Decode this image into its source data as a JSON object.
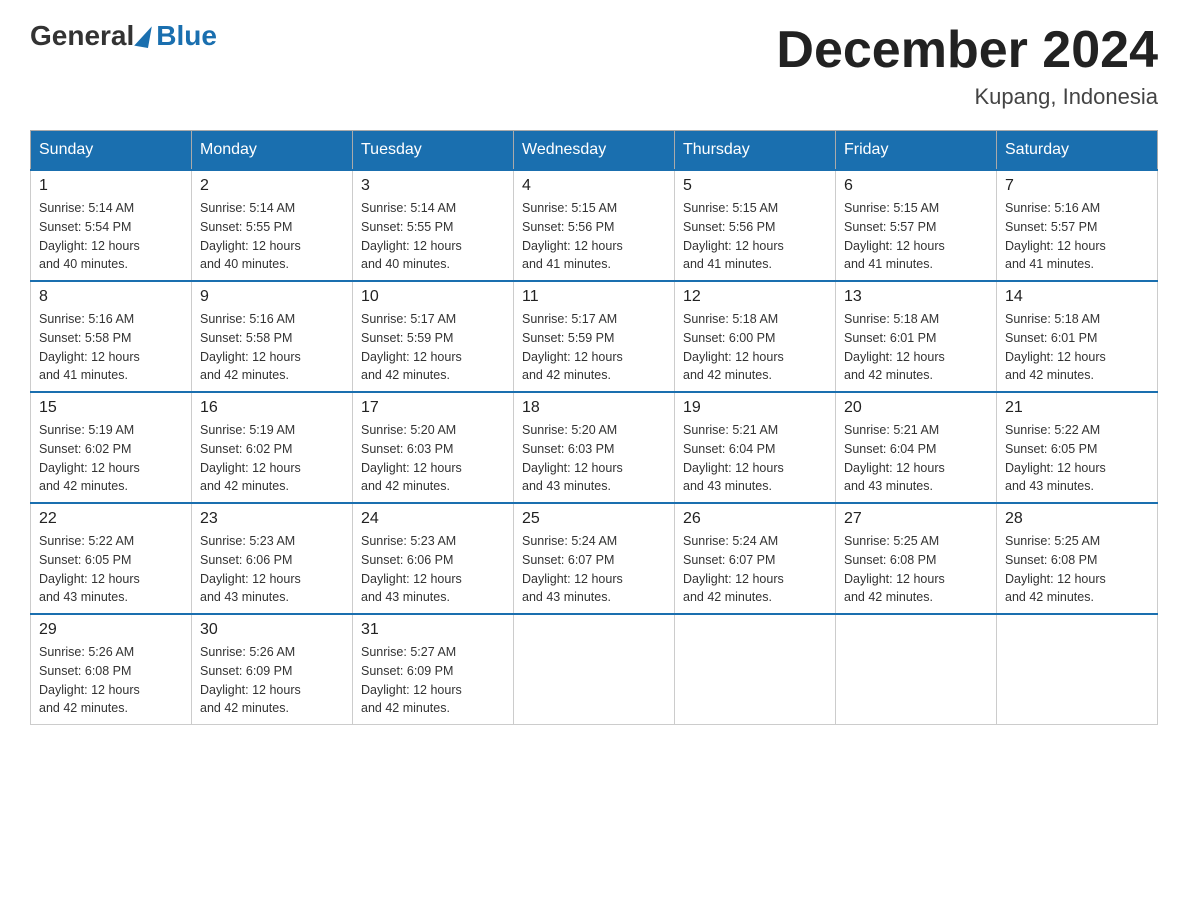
{
  "header": {
    "logo_general": "General",
    "logo_blue": "Blue",
    "month_title": "December 2024",
    "location": "Kupang, Indonesia"
  },
  "days_of_week": [
    "Sunday",
    "Monday",
    "Tuesday",
    "Wednesday",
    "Thursday",
    "Friday",
    "Saturday"
  ],
  "weeks": [
    [
      {
        "day": "1",
        "sunrise": "5:14 AM",
        "sunset": "5:54 PM",
        "daylight": "12 hours and 40 minutes."
      },
      {
        "day": "2",
        "sunrise": "5:14 AM",
        "sunset": "5:55 PM",
        "daylight": "12 hours and 40 minutes."
      },
      {
        "day": "3",
        "sunrise": "5:14 AM",
        "sunset": "5:55 PM",
        "daylight": "12 hours and 40 minutes."
      },
      {
        "day": "4",
        "sunrise": "5:15 AM",
        "sunset": "5:56 PM",
        "daylight": "12 hours and 41 minutes."
      },
      {
        "day": "5",
        "sunrise": "5:15 AM",
        "sunset": "5:56 PM",
        "daylight": "12 hours and 41 minutes."
      },
      {
        "day": "6",
        "sunrise": "5:15 AM",
        "sunset": "5:57 PM",
        "daylight": "12 hours and 41 minutes."
      },
      {
        "day": "7",
        "sunrise": "5:16 AM",
        "sunset": "5:57 PM",
        "daylight": "12 hours and 41 minutes."
      }
    ],
    [
      {
        "day": "8",
        "sunrise": "5:16 AM",
        "sunset": "5:58 PM",
        "daylight": "12 hours and 41 minutes."
      },
      {
        "day": "9",
        "sunrise": "5:16 AM",
        "sunset": "5:58 PM",
        "daylight": "12 hours and 42 minutes."
      },
      {
        "day": "10",
        "sunrise": "5:17 AM",
        "sunset": "5:59 PM",
        "daylight": "12 hours and 42 minutes."
      },
      {
        "day": "11",
        "sunrise": "5:17 AM",
        "sunset": "5:59 PM",
        "daylight": "12 hours and 42 minutes."
      },
      {
        "day": "12",
        "sunrise": "5:18 AM",
        "sunset": "6:00 PM",
        "daylight": "12 hours and 42 minutes."
      },
      {
        "day": "13",
        "sunrise": "5:18 AM",
        "sunset": "6:01 PM",
        "daylight": "12 hours and 42 minutes."
      },
      {
        "day": "14",
        "sunrise": "5:18 AM",
        "sunset": "6:01 PM",
        "daylight": "12 hours and 42 minutes."
      }
    ],
    [
      {
        "day": "15",
        "sunrise": "5:19 AM",
        "sunset": "6:02 PM",
        "daylight": "12 hours and 42 minutes."
      },
      {
        "day": "16",
        "sunrise": "5:19 AM",
        "sunset": "6:02 PM",
        "daylight": "12 hours and 42 minutes."
      },
      {
        "day": "17",
        "sunrise": "5:20 AM",
        "sunset": "6:03 PM",
        "daylight": "12 hours and 42 minutes."
      },
      {
        "day": "18",
        "sunrise": "5:20 AM",
        "sunset": "6:03 PM",
        "daylight": "12 hours and 43 minutes."
      },
      {
        "day": "19",
        "sunrise": "5:21 AM",
        "sunset": "6:04 PM",
        "daylight": "12 hours and 43 minutes."
      },
      {
        "day": "20",
        "sunrise": "5:21 AM",
        "sunset": "6:04 PM",
        "daylight": "12 hours and 43 minutes."
      },
      {
        "day": "21",
        "sunrise": "5:22 AM",
        "sunset": "6:05 PM",
        "daylight": "12 hours and 43 minutes."
      }
    ],
    [
      {
        "day": "22",
        "sunrise": "5:22 AM",
        "sunset": "6:05 PM",
        "daylight": "12 hours and 43 minutes."
      },
      {
        "day": "23",
        "sunrise": "5:23 AM",
        "sunset": "6:06 PM",
        "daylight": "12 hours and 43 minutes."
      },
      {
        "day": "24",
        "sunrise": "5:23 AM",
        "sunset": "6:06 PM",
        "daylight": "12 hours and 43 minutes."
      },
      {
        "day": "25",
        "sunrise": "5:24 AM",
        "sunset": "6:07 PM",
        "daylight": "12 hours and 43 minutes."
      },
      {
        "day": "26",
        "sunrise": "5:24 AM",
        "sunset": "6:07 PM",
        "daylight": "12 hours and 42 minutes."
      },
      {
        "day": "27",
        "sunrise": "5:25 AM",
        "sunset": "6:08 PM",
        "daylight": "12 hours and 42 minutes."
      },
      {
        "day": "28",
        "sunrise": "5:25 AM",
        "sunset": "6:08 PM",
        "daylight": "12 hours and 42 minutes."
      }
    ],
    [
      {
        "day": "29",
        "sunrise": "5:26 AM",
        "sunset": "6:08 PM",
        "daylight": "12 hours and 42 minutes."
      },
      {
        "day": "30",
        "sunrise": "5:26 AM",
        "sunset": "6:09 PM",
        "daylight": "12 hours and 42 minutes."
      },
      {
        "day": "31",
        "sunrise": "5:27 AM",
        "sunset": "6:09 PM",
        "daylight": "12 hours and 42 minutes."
      },
      null,
      null,
      null,
      null
    ]
  ],
  "labels": {
    "sunrise": "Sunrise:",
    "sunset": "Sunset:",
    "daylight": "Daylight:"
  }
}
